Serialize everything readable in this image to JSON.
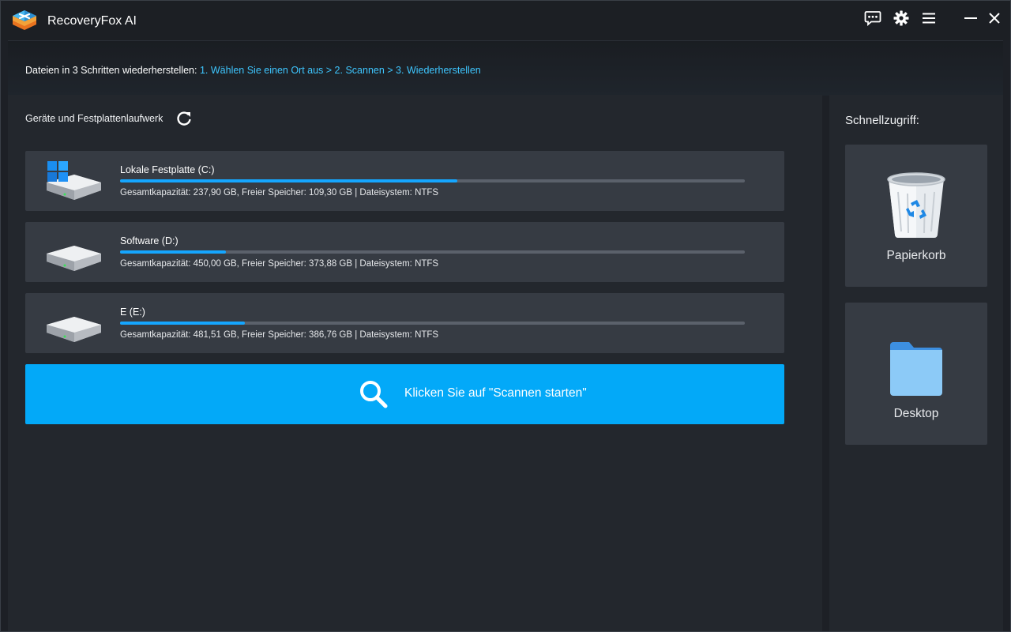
{
  "app": {
    "title": "RecoveryFox AI"
  },
  "titlebar": {
    "icons": [
      "chat-icon",
      "gear-icon",
      "menu-icon",
      "minimize-icon",
      "close-icon"
    ]
  },
  "steps": {
    "prefix": "Dateien in 3 Schritten wiederherstellen:",
    "path": "1. Wählen Sie einen Ort aus > 2. Scannen > 3. Wiederherstellen"
  },
  "devices": {
    "title": "Geräte und Festplattenlaufwerk",
    "drives": [
      {
        "name": "Lokale Festplatte (C:)",
        "info": "Gesamtkapazität: 237,90 GB, Freier Speicher: 109,30 GB | Dateisystem: NTFS",
        "used_fraction": 0.54,
        "icon": "windows-drive-icon"
      },
      {
        "name": "Software (D:)",
        "info": "Gesamtkapazität: 450,00 GB, Freier Speicher: 373,88 GB | Dateisystem: NTFS",
        "used_fraction": 0.17,
        "icon": "drive-icon"
      },
      {
        "name": "E (E:)",
        "info": "Gesamtkapazität: 481,51 GB, Freier Speicher: 386,76 GB | Dateisystem: NTFS",
        "used_fraction": 0.2,
        "icon": "drive-icon"
      }
    ],
    "scan_label": "Klicken Sie auf \"Scannen starten\""
  },
  "quick_access": {
    "title": "Schnellzugriff:",
    "items": [
      {
        "label": "Papierkorb",
        "icon": "recycle-bin-icon"
      },
      {
        "label": "Desktop",
        "icon": "folder-icon"
      }
    ]
  },
  "colors": {
    "accent": "#03a9f8",
    "progress": "#15a6ff",
    "steps_link": "#3ec6ff",
    "card": "#363b43",
    "panel": "#23272d"
  }
}
